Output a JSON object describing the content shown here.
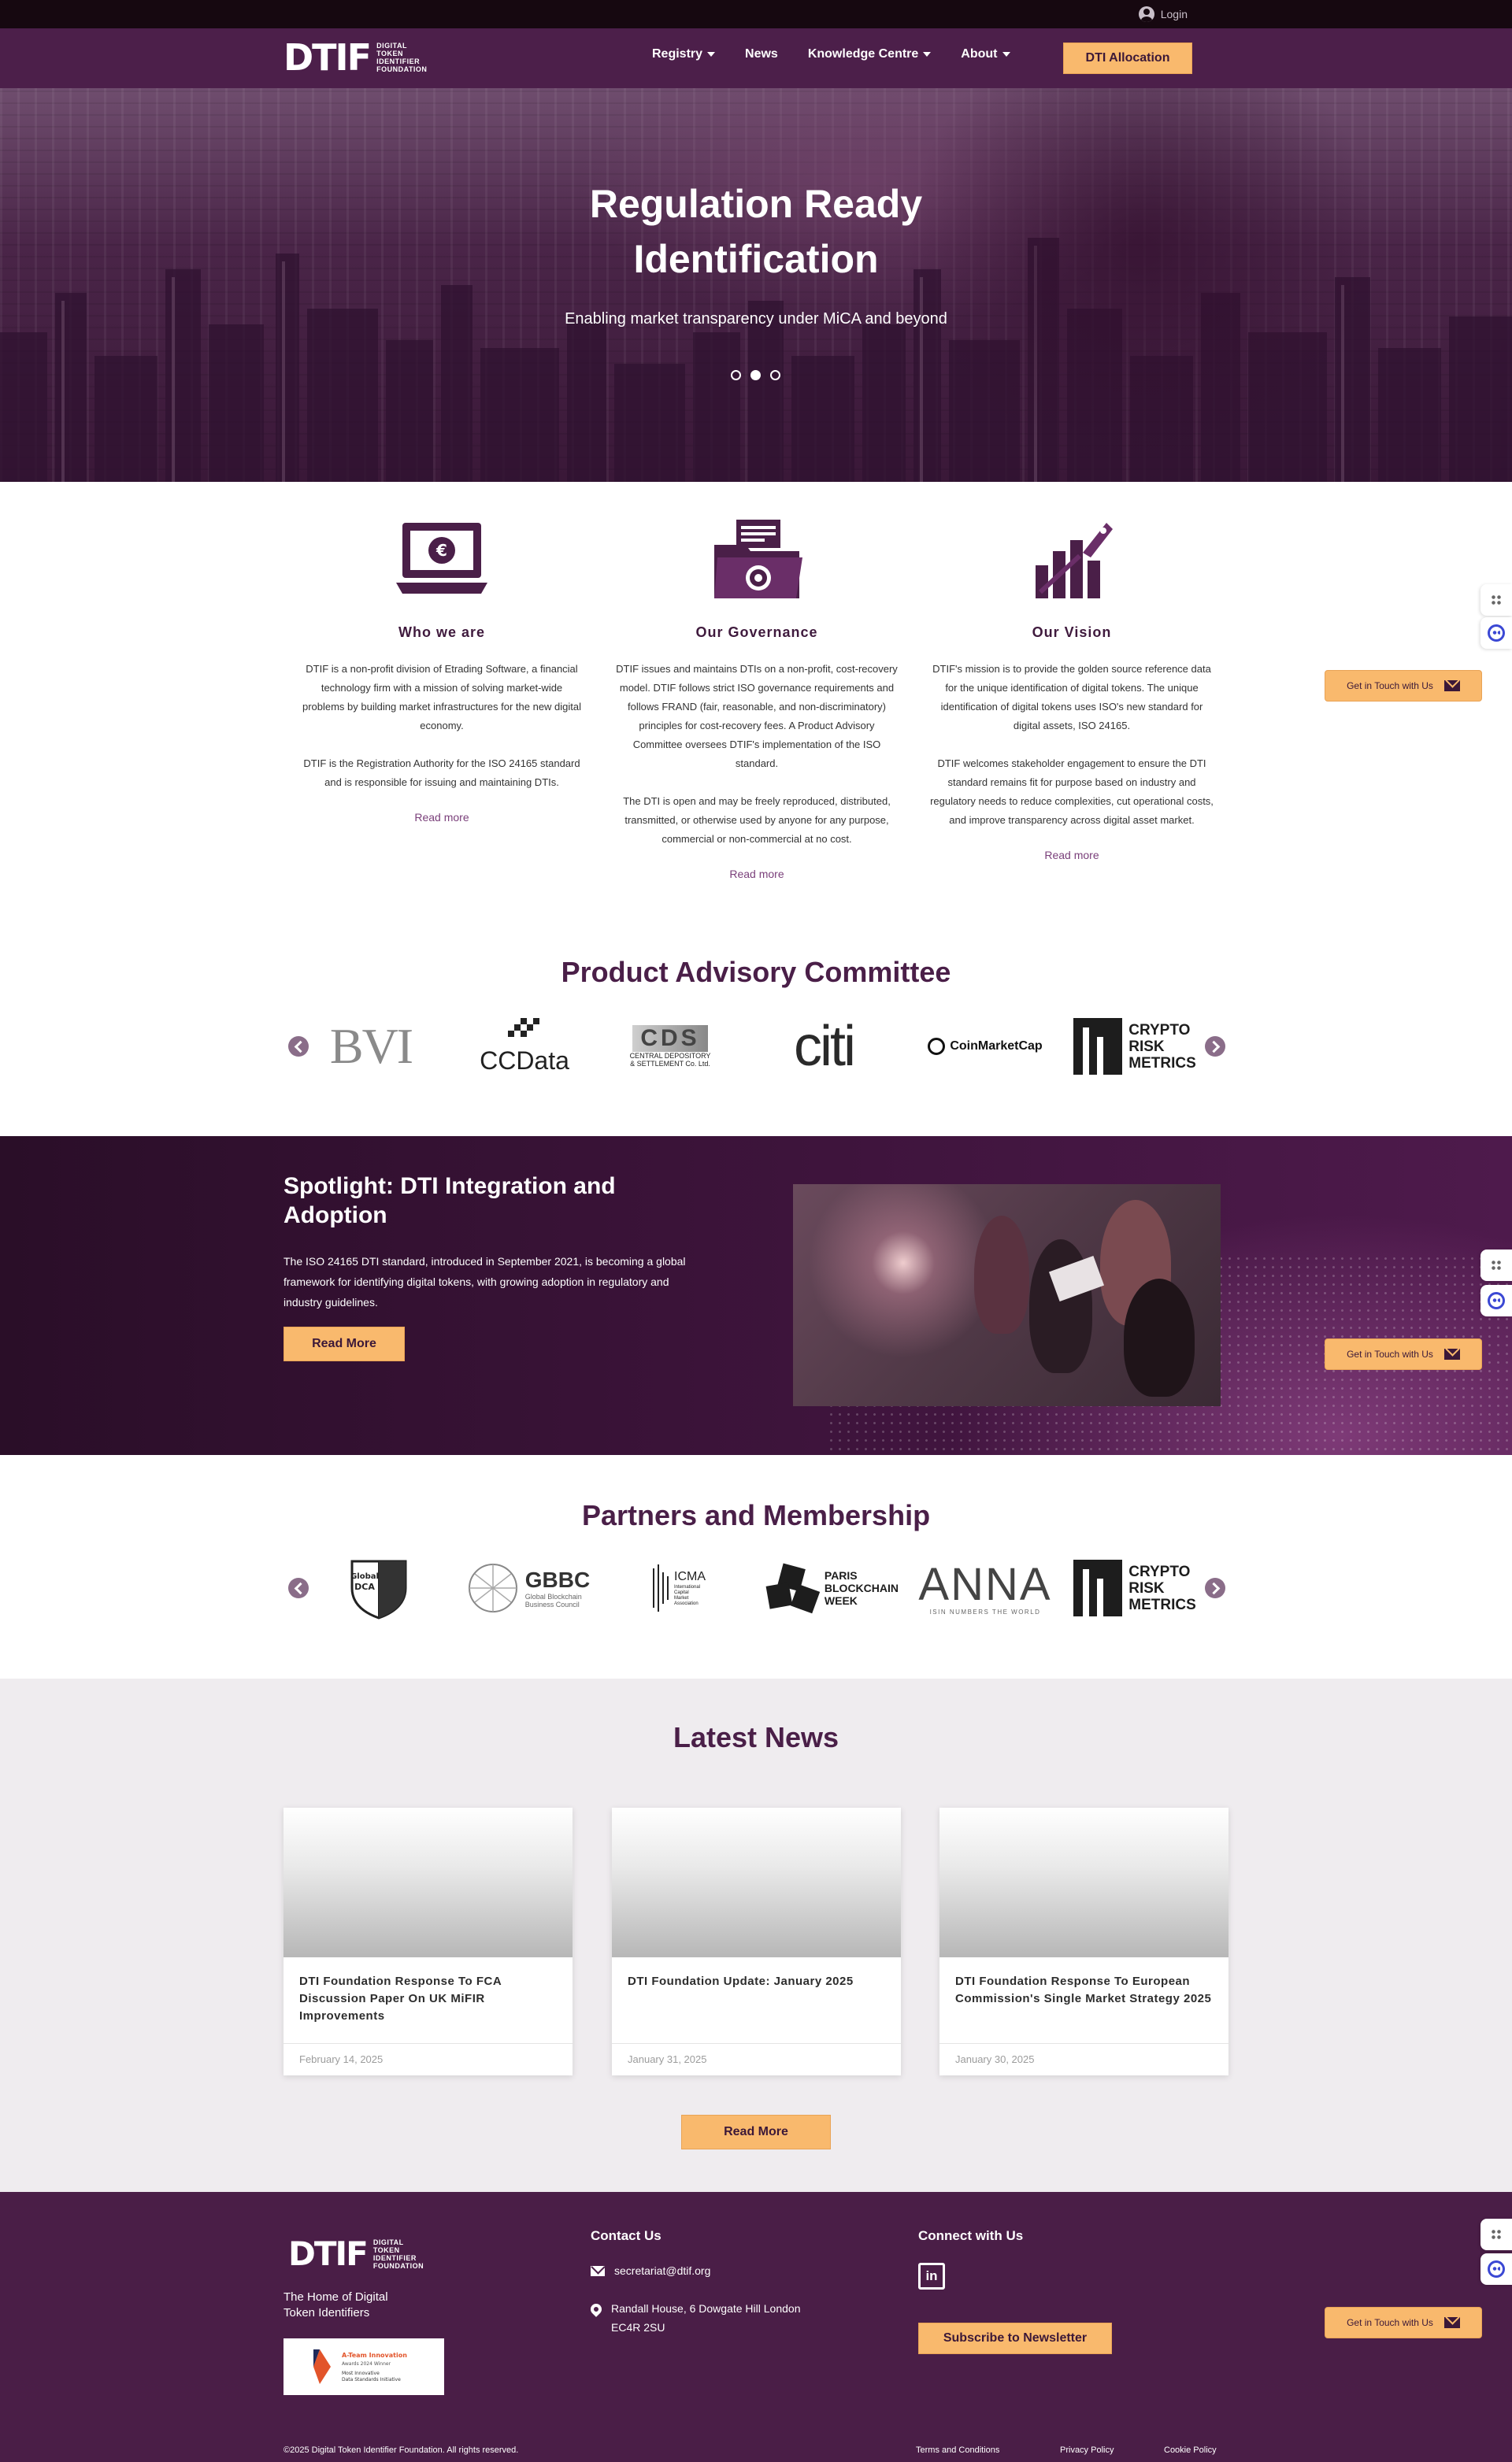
{
  "topbar": {
    "login_label": "Login"
  },
  "brand": {
    "logo_text": "DTIF",
    "logo_sub": [
      "DIGITAL",
      "TOKEN",
      "IDENTIFIER",
      "FOUNDATION"
    ]
  },
  "nav": {
    "items": [
      {
        "label": "Registry",
        "has_dropdown": true
      },
      {
        "label": "News",
        "has_dropdown": false
      },
      {
        "label": "Knowledge Centre",
        "has_dropdown": true
      },
      {
        "label": "About",
        "has_dropdown": true
      }
    ],
    "cta_label": "DTI Allocation"
  },
  "hero": {
    "title_line1": "Regulation Ready",
    "title_line2": "Identification",
    "subtitle": "Enabling market transparency under MiCA and beyond",
    "slides_total": 3,
    "active_slide": 2
  },
  "about": {
    "who": {
      "title": "Who we are",
      "p1": "DTIF is a non-profit division of Etrading Software, a financial technology firm with a mission of solving market-wide problems by building market infrastructures for the new digital economy.",
      "p2": "DTIF is the Registration Authority for the ISO 24165 standard and is responsible for issuing and maintaining DTIs.",
      "link": "Read more"
    },
    "governance": {
      "title": "Our Governance",
      "p1": "DTIF issues and maintains DTIs on a non-profit, cost-recovery model. DTIF follows strict ISO governance requirements and follows FRAND (fair, reasonable, and non-discriminatory) principles for cost-recovery fees. A Product Advisory Committee oversees DTIF's implementation of the ISO standard.",
      "p2": "The DTI is open and may be freely reproduced, distributed, transmitted, or otherwise used by anyone for any purpose, commercial or non-commercial at no cost.",
      "link": "Read more"
    },
    "vision": {
      "title": "Our Vision",
      "p1": "DTIF's mission is to provide the golden source reference data for the unique identification of digital tokens. The unique identification of digital tokens uses ISO's new standard for digital assets, ISO 24165.",
      "p2": "DTIF welcomes stakeholder engagement to ensure the DTI standard remains fit for purpose based on industry and regulatory needs to reduce complexities, cut operational costs, and improve transparency across digital asset market.",
      "link": "Read more"
    }
  },
  "pac": {
    "title": "Product Advisory Committee",
    "logos": {
      "bvi": "BVI",
      "ccdata": "CCData",
      "cds": "CDS",
      "cds_sub1": "CENTRAL DEPOSITORY",
      "cds_sub2": "& SETTLEMENT Co. Ltd.",
      "citi": "citi",
      "cmc": "CoinMarketCap",
      "crm": [
        "CRYPTO",
        "RISK",
        "METRICS"
      ]
    }
  },
  "spotlight": {
    "title": "Spotlight: DTI Integration and Adoption",
    "text": "The ISO 24165 DTI standard, introduced in September 2021, is becoming a global framework for identifying digital tokens, with growing adoption in regulatory and industry guidelines.",
    "button": "Read More"
  },
  "partners": {
    "title": "Partners and Membership",
    "logos": {
      "gdca1": "Global",
      "gdca2": "DCA",
      "gbbc": "GBBC",
      "gbbc_sub1": "Global Blockchain",
      "gbbc_sub2": "Business Council",
      "icma": "ICMA",
      "icma_sub": [
        "International",
        "Capital",
        "Market",
        "Association"
      ],
      "pbw": [
        "PARIS",
        "BLOCKCHAIN",
        "WEEK"
      ],
      "anna": "ANNA",
      "anna_sub": "ISIN NUMBERS THE WORLD",
      "crm": [
        "CRYPTO",
        "RISK",
        "METRICS"
      ]
    }
  },
  "news": {
    "title": "Latest News",
    "cards": [
      {
        "title": "DTI Foundation Response To FCA Discussion Paper On UK MiFIR Improvements",
        "date": "February 14, 2025"
      },
      {
        "title": "DTI Foundation Update: January 2025",
        "date": "January 31, 2025"
      },
      {
        "title": "DTI Foundation Response To European Commission's Single Market Strategy 2025",
        "date": "January 30, 2025"
      }
    ],
    "button": "Read More"
  },
  "footer": {
    "tagline_l1": "The Home of Digital",
    "tagline_l2": "Token Identifiers",
    "award_l1": "A-Team Innovation",
    "award_l2": "Awards 2024 Winner",
    "award_l3": "Most Innovative",
    "award_l4": "Data Standards Initiative",
    "contact_title": "Contact Us",
    "email": "secretariat@dtif.org",
    "address_l1": "Randall House, 6 Dowgate Hill London",
    "address_l2": "EC4R 2SU",
    "connect_title": "Connect with Us",
    "linkedin": "in",
    "subscribe": "Subscribe to Newsletter",
    "copyright": "©2025 Digital Token Identifier Foundation. All rights reserved.",
    "links": [
      "Terms and Conditions",
      "Privacy Policy",
      "Cookie Policy"
    ]
  },
  "widgets": {
    "get_in_touch": "Get in Touch with Us"
  },
  "colors": {
    "brand_purple": "#4c1f4a",
    "accent_orange": "#f9b96d",
    "dark": "#160810"
  },
  "icons": [
    "user-icon",
    "caret-down-icon",
    "laptop-coin-icon",
    "folder-gear-icon",
    "growth-rocket-icon",
    "chevron-left-icon",
    "chevron-right-icon",
    "mail-icon",
    "location-pin-icon",
    "linkedin-icon",
    "envelope-icon",
    "apps-grid-icon",
    "chatbot-icon"
  ]
}
